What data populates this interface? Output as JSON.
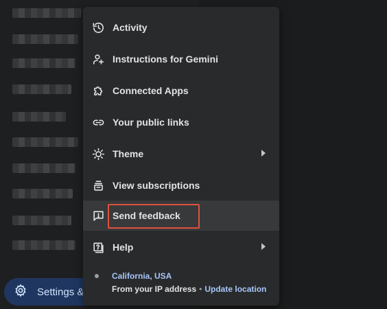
{
  "menu": {
    "items": [
      {
        "label": "Activity",
        "icon": "history-icon",
        "has_submenu": false
      },
      {
        "label": "Instructions for Gemini",
        "icon": "person-add-icon",
        "has_submenu": false
      },
      {
        "label": "Connected Apps",
        "icon": "puzzle-icon",
        "has_submenu": false
      },
      {
        "label": "Your public links",
        "icon": "link-icon",
        "has_submenu": false
      },
      {
        "label": "Theme",
        "icon": "brightness-icon",
        "has_submenu": true
      },
      {
        "label": "View subscriptions",
        "icon": "subscriptions-icon",
        "has_submenu": false
      },
      {
        "label": "Send feedback",
        "icon": "feedback-icon",
        "has_submenu": false
      },
      {
        "label": "Help",
        "icon": "help-icon",
        "has_submenu": true
      }
    ],
    "location": {
      "place": "California, USA",
      "source": "From your IP address",
      "separator": "•",
      "update_label": "Update location"
    }
  },
  "sidebar": {
    "settings_label": "Settings &"
  },
  "colors": {
    "menu_bg": "#282a2c",
    "highlight_bg": "#37393b",
    "annotation_red": "#e0523c",
    "link_blue": "#a8c7fa",
    "settings_pill_bg": "#1f3760"
  }
}
